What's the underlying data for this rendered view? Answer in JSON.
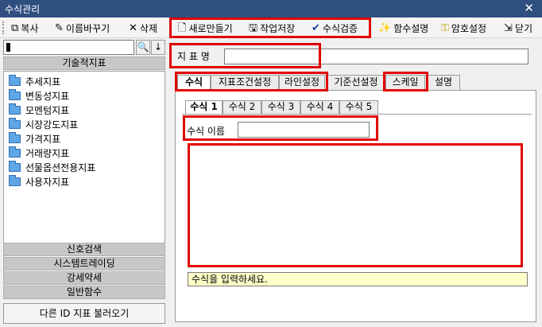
{
  "window": {
    "title": "수식관리",
    "close_label": "✕"
  },
  "toolbar": {
    "copy": "복사",
    "rename": "이름바꾸기",
    "delete": "삭제",
    "new": "새로만들기",
    "save": "작업저장",
    "verify": "수식검증",
    "func_help": "함수설명",
    "password": "암호설정",
    "close": "닫기"
  },
  "left": {
    "search_button": "🔍",
    "down_button": "↓",
    "category": "기술적지표",
    "tree": [
      "추세지표",
      "변동성지표",
      "모멘텀지표",
      "시장강도지표",
      "가격지표",
      "거래량지표",
      "선물옵션전용지표",
      "사용자지표"
    ],
    "groups": [
      "신호검색",
      "시스템트레이딩",
      "강세약세",
      "일반함수"
    ],
    "load_other": "다른 ID 지표 불러오기"
  },
  "right": {
    "name_label": "지 표 명",
    "name_value": "",
    "tabs": [
      "수식",
      "지표조건설정",
      "라인설정",
      "기준선설정",
      "스케일",
      "설명"
    ],
    "subtabs": [
      "수식 1",
      "수식 2",
      "수식 3",
      "수식 4",
      "수식 5"
    ],
    "formula_name_label": "수식 이름",
    "formula_name_value": "",
    "hint": "수식을 입력하세요."
  },
  "colors": {
    "titlebar": "#2f4f80",
    "highlight": "#e00000",
    "hint_bg": "#ffffc8"
  }
}
